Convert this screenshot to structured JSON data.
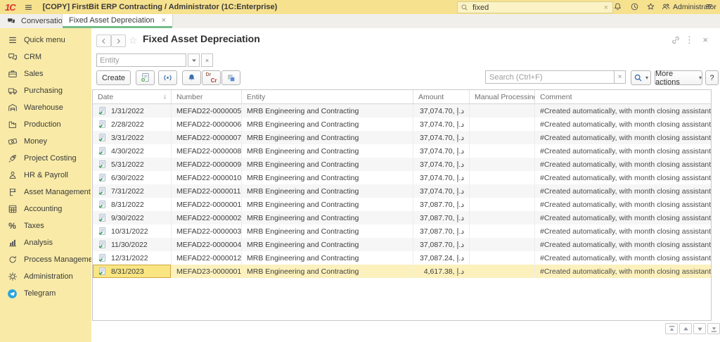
{
  "topbar": {
    "logo": "1C",
    "title": "[COPY] FirstBit ERP Contracting / Administrator  (1C:Enterprise)",
    "search": {
      "value": "fixed"
    },
    "user": "Administrator"
  },
  "tabs": {
    "conversations": "Conversations",
    "active": {
      "label": "Fixed Asset Depreciation"
    }
  },
  "sidebar": {
    "items": [
      {
        "label": "Quick menu",
        "icon": "quick-menu-icon"
      },
      {
        "label": "CRM",
        "icon": "crm-icon"
      },
      {
        "label": "Sales",
        "icon": "sales-icon"
      },
      {
        "label": "Purchasing",
        "icon": "purchasing-icon"
      },
      {
        "label": "Warehouse",
        "icon": "warehouse-icon"
      },
      {
        "label": "Production",
        "icon": "production-icon"
      },
      {
        "label": "Money",
        "icon": "money-icon"
      },
      {
        "label": "Project Costing",
        "icon": "project-costing-icon"
      },
      {
        "label": "HR & Payroll",
        "icon": "hr-payroll-icon"
      },
      {
        "label": "Asset Management",
        "icon": "asset-management-icon"
      },
      {
        "label": "Accounting",
        "icon": "accounting-icon"
      },
      {
        "label": "Taxes",
        "icon": "taxes-icon"
      },
      {
        "label": "Analysis",
        "icon": "analysis-icon"
      },
      {
        "label": "Process Management",
        "icon": "process-management-icon"
      },
      {
        "label": "Administration",
        "icon": "administration-icon"
      },
      {
        "label": "Telegram",
        "icon": "telegram-icon"
      }
    ]
  },
  "page": {
    "title": "Fixed Asset Depreciation",
    "filter": {
      "placeholder": "Entity"
    },
    "toolbar": {
      "create_label": "Create",
      "search_placeholder": "Search (Ctrl+F)",
      "more_actions_label": "More actions",
      "help_label": "?"
    }
  },
  "table": {
    "columns": [
      {
        "label": "Date"
      },
      {
        "label": "Number"
      },
      {
        "label": "Entity"
      },
      {
        "label": "Amount"
      },
      {
        "label": "Manual Processing"
      },
      {
        "label": "Comment"
      }
    ],
    "rows": [
      {
        "date": "1/31/2022",
        "number": "MEFAD22-0000005",
        "entity": "MRB Engineering and Contracting",
        "amount": "37,074.70, د.إ",
        "manual": "",
        "comment": "#Created automatically, with month closing assistant."
      },
      {
        "date": "2/28/2022",
        "number": "MEFAD22-0000006",
        "entity": "MRB Engineering and Contracting",
        "amount": "37,074.70, د.إ",
        "manual": "",
        "comment": "#Created automatically, with month closing assistant."
      },
      {
        "date": "3/31/2022",
        "number": "MEFAD22-0000007",
        "entity": "MRB Engineering and Contracting",
        "amount": "37,074.70, د.إ",
        "manual": "",
        "comment": "#Created automatically, with month closing assistant."
      },
      {
        "date": "4/30/2022",
        "number": "MEFAD22-0000008",
        "entity": "MRB Engineering and Contracting",
        "amount": "37,074.70, د.إ",
        "manual": "",
        "comment": "#Created automatically, with month closing assistant."
      },
      {
        "date": "5/31/2022",
        "number": "MEFAD22-0000009",
        "entity": "MRB Engineering and Contracting",
        "amount": "37,074.70, د.إ",
        "manual": "",
        "comment": "#Created automatically, with month closing assistant."
      },
      {
        "date": "6/30/2022",
        "number": "MEFAD22-0000010",
        "entity": "MRB Engineering and Contracting",
        "amount": "37,074.70, د.إ",
        "manual": "",
        "comment": "#Created automatically, with month closing assistant."
      },
      {
        "date": "7/31/2022",
        "number": "MEFAD22-0000011",
        "entity": "MRB Engineering and Contracting",
        "amount": "37,074.70, د.إ",
        "manual": "",
        "comment": "#Created automatically, with month closing assistant."
      },
      {
        "date": "8/31/2022",
        "number": "MEFAD22-0000001",
        "entity": "MRB Engineering and Contracting",
        "amount": "37,087.70, د.إ",
        "manual": "",
        "comment": "#Created automatically, with month closing assistant."
      },
      {
        "date": "9/30/2022",
        "number": "MEFAD22-0000002",
        "entity": "MRB Engineering and Contracting",
        "amount": "37,087.70, د.إ",
        "manual": "",
        "comment": "#Created automatically, with month closing assistant."
      },
      {
        "date": "10/31/2022",
        "number": "MEFAD22-0000003",
        "entity": "MRB Engineering and Contracting",
        "amount": "37,087.70, د.إ",
        "manual": "",
        "comment": "#Created automatically, with month closing assistant."
      },
      {
        "date": "11/30/2022",
        "number": "MEFAD22-0000004",
        "entity": "MRB Engineering and Contracting",
        "amount": "37,087.70, د.إ",
        "manual": "",
        "comment": "#Created automatically, with month closing assistant."
      },
      {
        "date": "12/31/2022",
        "number": "MEFAD22-0000012",
        "entity": "MRB Engineering and Contracting",
        "amount": "37,087.24, د.إ",
        "manual": "",
        "comment": "#Created automatically, with month closing assistant."
      },
      {
        "date": "8/31/2023",
        "number": "MEFAD23-0000001",
        "entity": "MRB Engineering and Contracting",
        "amount": "4,617.38, د.إ",
        "manual": "",
        "comment": "#Created automatically, with month closing assistant.",
        "selected": true
      }
    ]
  }
}
